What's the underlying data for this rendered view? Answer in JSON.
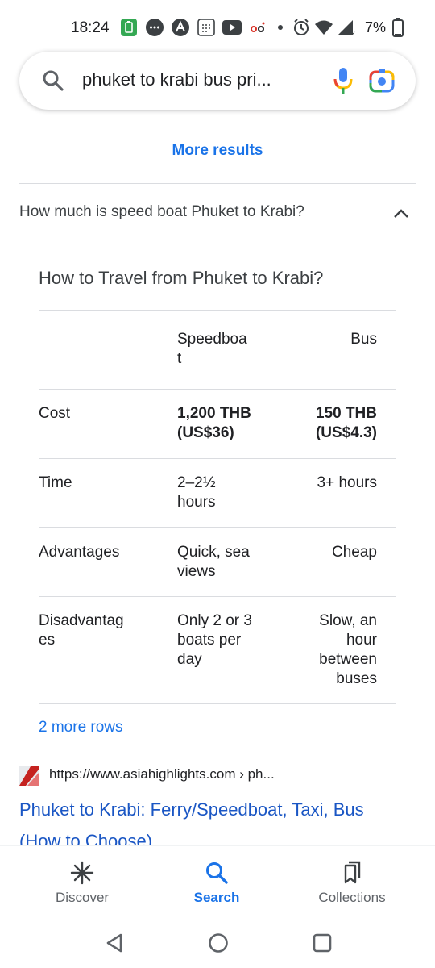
{
  "status_bar": {
    "time": "18:24",
    "battery": "7%"
  },
  "search": {
    "query": "phuket to krabi bus pri..."
  },
  "more_results": "More results",
  "question": "How much is speed boat Phuket to Krabi?",
  "card": {
    "title": "How to Travel from Phuket to Krabi?",
    "headers": [
      "",
      "Speedboa\nt",
      "Bus"
    ],
    "rows": [
      {
        "label": "Cost",
        "speedboat": "1,200 THB\n(US$36)",
        "bus": "150 THB\n(US$4.3)"
      },
      {
        "label": "Time",
        "speedboat": "2–2½\nhours",
        "bus": "3+ hours"
      },
      {
        "label": "Advantages",
        "speedboat": "Quick, sea\nviews",
        "bus": "Cheap"
      },
      {
        "label": "Disadvantag\nes",
        "speedboat": "Only 2 or 3\nboats per\nday",
        "bus": "Slow, an\nhour\nbetween\nbuses"
      }
    ],
    "more_rows": "2 more rows"
  },
  "result": {
    "url": "https://www.asiahighlights.com › ph...",
    "title": "Phuket to Krabi: Ferry/Speedboat, Taxi, Bus (How to Choose)"
  },
  "bottom_nav": {
    "items": [
      {
        "label": "Discover",
        "icon": "asterisk-icon"
      },
      {
        "label": "Search",
        "icon": "search-icon"
      },
      {
        "label": "Collections",
        "icon": "bookmarks-icon"
      }
    ]
  },
  "colors": {
    "link": "#1a73e8",
    "title_link": "#1a56c4",
    "text": "#202124",
    "divider": "#dadce0"
  }
}
